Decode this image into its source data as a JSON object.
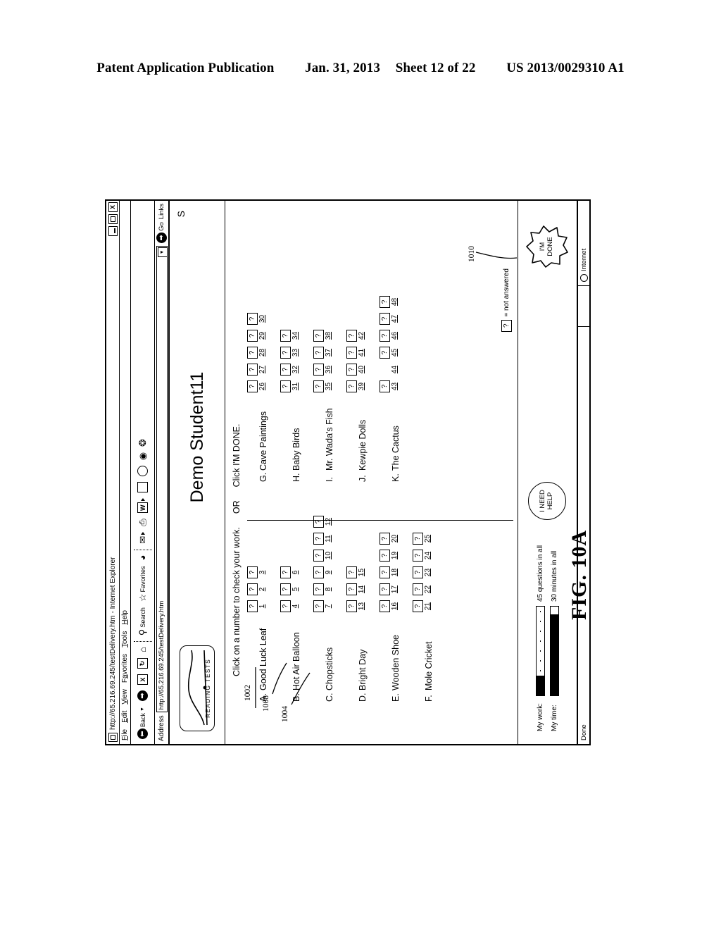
{
  "patent_header": {
    "publication": "Patent Application Publication",
    "date": "Jan. 31, 2013",
    "sheet": "Sheet 12 of 22",
    "number": "US 2013/0029310 A1"
  },
  "figure": {
    "caption": "FIG. 10A",
    "reference_numerals": [
      "1002",
      "1004",
      "1008",
      "1010"
    ]
  },
  "browser": {
    "title": "http://65.216.69.245/testDelivery.htm - Internet Explorer",
    "window_buttons": {
      "minimize": "_",
      "maximize": "□",
      "close": "X"
    },
    "menu": [
      {
        "label": "File",
        "accel": "F"
      },
      {
        "label": "Edit",
        "accel": "E"
      },
      {
        "label": "View",
        "accel": "V"
      },
      {
        "label": "Favorites",
        "accel": "a"
      },
      {
        "label": "Tools",
        "accel": "T"
      },
      {
        "label": "Help",
        "accel": "H"
      }
    ],
    "toolbar": [
      {
        "name": "back-button",
        "label": "Back",
        "icon": "back-arrow-icon"
      },
      {
        "name": "forward-button",
        "label": "",
        "icon": "forward-arrow-icon"
      },
      {
        "name": "stop-button",
        "label": "",
        "icon": "stop-icon"
      },
      {
        "name": "refresh-button",
        "label": "",
        "icon": "refresh-icon"
      },
      {
        "name": "home-button",
        "label": "",
        "icon": "home-icon"
      },
      {
        "name": "search-button",
        "label": "Search",
        "icon": "search-icon"
      },
      {
        "name": "favorites-button",
        "label": "Favorites",
        "icon": "star-icon"
      },
      {
        "name": "history-button",
        "label": "",
        "icon": "history-icon"
      },
      {
        "name": "mail-button",
        "label": "",
        "icon": "mail-icon"
      },
      {
        "name": "print-button",
        "label": "",
        "icon": "printer-icon"
      },
      {
        "name": "edit-button",
        "label": "",
        "icon": "edit-word-icon"
      },
      {
        "name": "discuss-button",
        "label": "",
        "icon": "page-icon"
      },
      {
        "name": "research-button",
        "label": "",
        "icon": "magnifier-icon"
      },
      {
        "name": "messenger-button",
        "label": "",
        "icon": "messenger-icon"
      },
      {
        "name": "media-button",
        "label": "",
        "icon": "media-icon"
      }
    ],
    "address": {
      "label": "Address",
      "value": "http://65.216.69.245/testDelivery.htm",
      "go_label": "Go",
      "links_label": "Links"
    },
    "status": {
      "text": "Done",
      "zone": "Internet"
    }
  },
  "page": {
    "logo_text": "READING TESTS",
    "student_name": "Demo Student11",
    "corner_letter": "S",
    "instructions": {
      "part1": "Click on a number to check your work.",
      "part2": "OR",
      "part3": "Click I'M DONE."
    },
    "legend": {
      "symbol": "?",
      "text": "= not answered"
    },
    "left_groups": [
      {
        "letter": "A.",
        "title": "Good Luck Leaf",
        "numbers": [
          1,
          2,
          3
        ],
        "boxed": [
          true,
          true,
          true
        ]
      },
      {
        "letter": "B.",
        "title": "Hot Air Balloon",
        "numbers": [
          4,
          5,
          6
        ],
        "boxed": [
          true,
          true,
          true
        ]
      },
      {
        "letter": "C.",
        "title": "Chopsticks",
        "numbers": [
          7,
          8,
          9,
          10,
          11,
          12
        ],
        "boxed": [
          true,
          true,
          true,
          true,
          true,
          true
        ]
      },
      {
        "letter": "D.",
        "title": "Bright Day",
        "numbers": [
          13,
          14,
          15
        ],
        "boxed": [
          true,
          true,
          true
        ]
      },
      {
        "letter": "E.",
        "title": "Wooden Shoe",
        "numbers": [
          16,
          17,
          18,
          19,
          20
        ],
        "boxed": [
          true,
          true,
          true,
          true,
          true
        ]
      },
      {
        "letter": "F.",
        "title": "Mole Cricket",
        "numbers": [
          21,
          22,
          23,
          24,
          25
        ],
        "boxed": [
          true,
          true,
          true,
          true,
          true
        ]
      }
    ],
    "right_groups": [
      {
        "letter": "G.",
        "title": "Cave Paintings",
        "numbers": [
          26,
          27,
          28,
          29,
          30
        ],
        "boxed": [
          true,
          true,
          true,
          true,
          true
        ]
      },
      {
        "letter": "H.",
        "title": "Baby Birds",
        "numbers": [
          31,
          32,
          33,
          34
        ],
        "boxed": [
          true,
          true,
          true,
          true
        ]
      },
      {
        "letter": "I.",
        "title": "Mr. Wada's Fish",
        "numbers": [
          35,
          36,
          37,
          38
        ],
        "boxed": [
          true,
          true,
          true,
          true
        ]
      },
      {
        "letter": "J.",
        "title": "Kewpie Dolls",
        "numbers": [
          39,
          40,
          41,
          42
        ],
        "boxed": [
          true,
          true,
          true,
          true
        ]
      },
      {
        "letter": "K.",
        "title": "The Cactus",
        "numbers": [
          43,
          44,
          45,
          46,
          47,
          48
        ],
        "boxed": [
          true,
          false,
          true,
          true,
          true,
          true
        ]
      }
    ],
    "question_mark": "?",
    "meters": [
      {
        "label": "My work:",
        "caption": "45 questions in all",
        "fill_percent": 22,
        "dotted": true
      },
      {
        "label": "My time:",
        "caption": "30 minutes in all",
        "fill_percent": 91,
        "dotted": false
      }
    ],
    "help_button": {
      "line1": "I NEED",
      "line2": "HELP"
    },
    "done_button": {
      "line1": "I'M",
      "line2": "DONE"
    }
  }
}
